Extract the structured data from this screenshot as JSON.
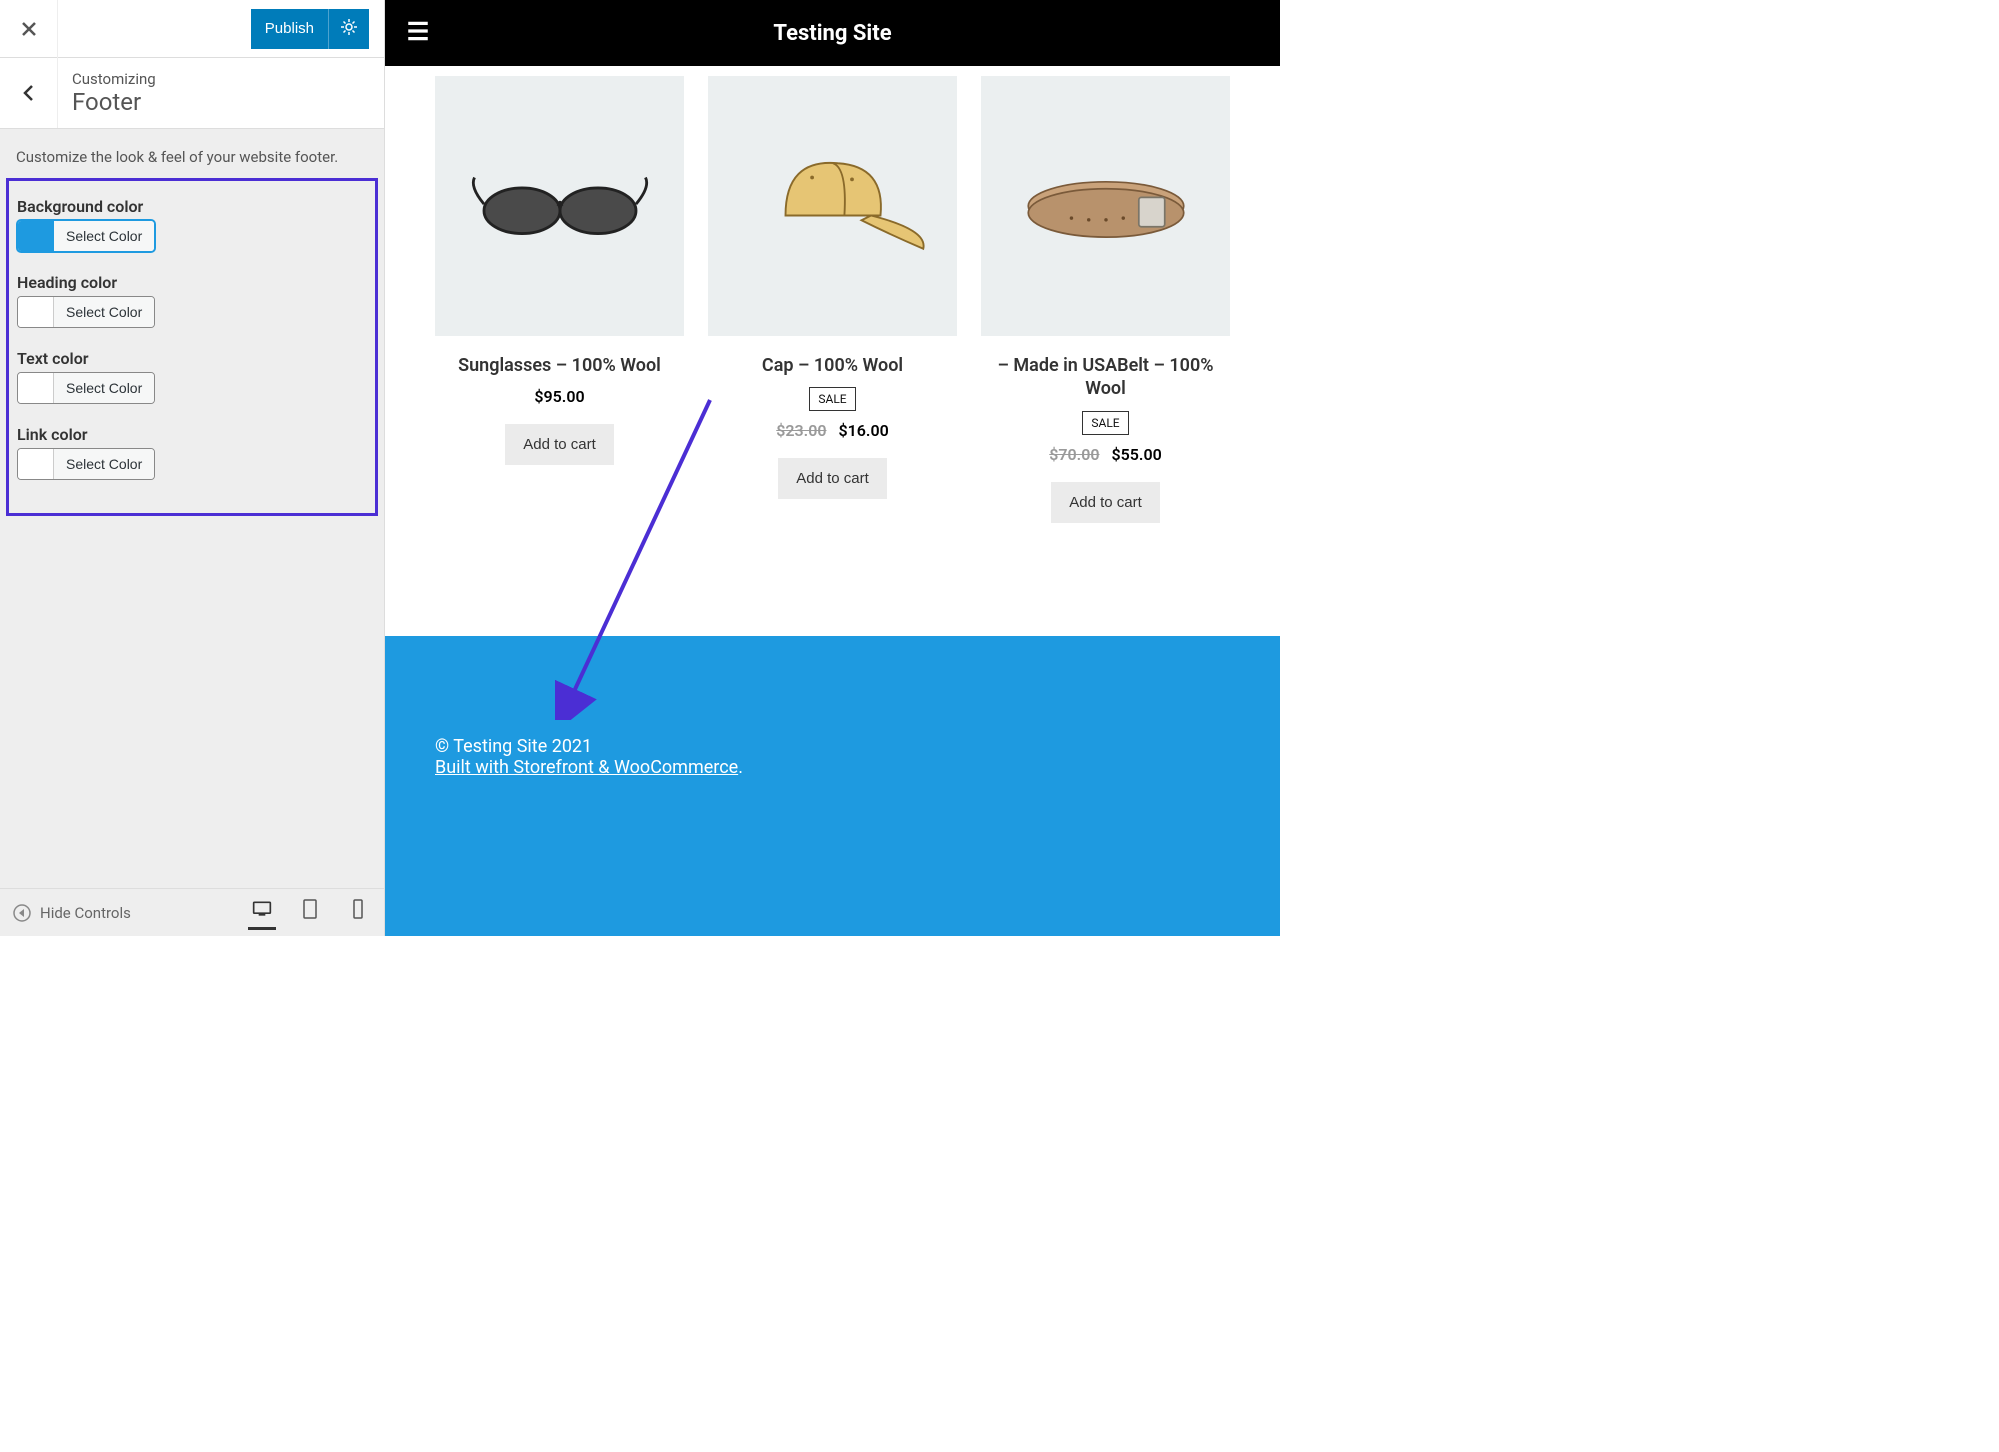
{
  "sidebar": {
    "publish_label": "Publish",
    "customizing_label": "Customizing",
    "section_name": "Footer",
    "description": "Customize the look & feel of your website footer.",
    "controls": {
      "background": {
        "label": "Background color",
        "button": "Select Color",
        "swatch": "#1e9ae0"
      },
      "heading": {
        "label": "Heading color",
        "button": "Select Color",
        "swatch": "#ffffff"
      },
      "text": {
        "label": "Text color",
        "button": "Select Color",
        "swatch": "#ffffff"
      },
      "link": {
        "label": "Link color",
        "button": "Select Color",
        "swatch": "#ffffff"
      }
    },
    "hide_controls_label": "Hide Controls"
  },
  "preview": {
    "site_title": "Testing Site",
    "products": [
      {
        "title": "Sunglasses – 100% Wool",
        "price": "$95.00",
        "old_price": "",
        "sale": false,
        "cta": "Add to cart",
        "illustration": "sunglasses"
      },
      {
        "title": "Cap – 100% Wool",
        "price": "$16.00",
        "old_price": "$23.00",
        "sale": true,
        "sale_text": "SALE",
        "cta": "Add to cart",
        "illustration": "cap"
      },
      {
        "title": "– Made in USABelt – 100% Wool",
        "price": "$55.00",
        "old_price": "$70.00",
        "sale": true,
        "sale_text": "SALE",
        "cta": "Add to cart",
        "illustration": "belt"
      }
    ],
    "footer": {
      "copyright": "© Testing Site 2021",
      "built_with": "Built with Storefront & WooCommerce",
      "trailing": "."
    }
  },
  "annotation": {
    "highlight_color": "#4b2ed4"
  }
}
